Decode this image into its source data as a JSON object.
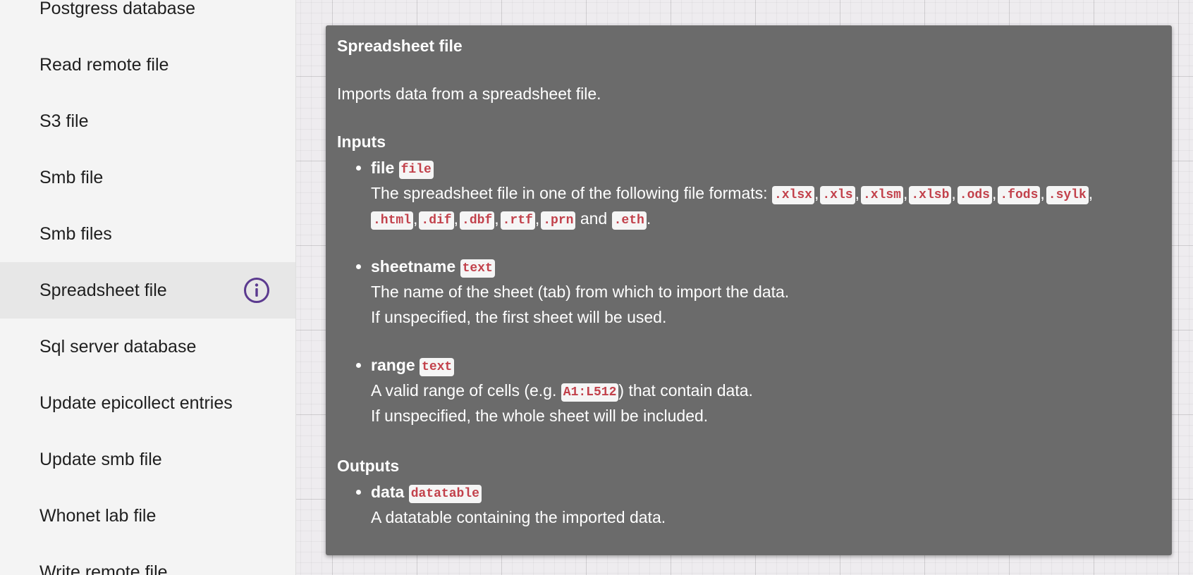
{
  "sidebar": {
    "items": [
      {
        "label": "Postgress database"
      },
      {
        "label": "Read remote file"
      },
      {
        "label": "S3 file"
      },
      {
        "label": "Smb file"
      },
      {
        "label": "Smb files"
      },
      {
        "label": "Spreadsheet file",
        "active": true,
        "icon": "info-icon"
      },
      {
        "label": "Sql server database"
      },
      {
        "label": "Update epicollect entries"
      },
      {
        "label": "Update smb file"
      },
      {
        "label": "Whonet lab file"
      },
      {
        "label": "Write remote file"
      }
    ]
  },
  "colors": {
    "info_icon": "#5b3a8f",
    "panel_bg": "#6b6b6b",
    "badge_text": "#c2414b"
  },
  "doc": {
    "title": "Spreadsheet file",
    "description": "Imports data from a spreadsheet file.",
    "inputs_title": "Inputs",
    "outputs_title": "Outputs",
    "inputs": [
      {
        "name": "file",
        "type": "file",
        "desc_prefix": "The spreadsheet file in one of the following file formats:",
        "formats": [
          ".xlsx",
          ".xls",
          ".xlsm",
          ".xlsb",
          ".ods",
          ".fods",
          ".sylk",
          ".html",
          ".dif",
          ".dbf",
          ".rtf",
          ".prn"
        ],
        "and_word": "and",
        "last_format": ".eth"
      },
      {
        "name": "sheetname",
        "type": "text",
        "line1": "The name of the sheet (tab) from which to import the data.",
        "line2": "If unspecified, the first sheet will be used."
      },
      {
        "name": "range",
        "type": "text",
        "line1_prefix": "A valid range of cells (e.g.",
        "example": "A1:L512",
        "line1_suffix": ") that contain data.",
        "line2": "If unspecified, the whole sheet will be included."
      }
    ],
    "outputs": [
      {
        "name": "data",
        "type": "datatable",
        "line1": "A datatable containing the imported data."
      }
    ]
  }
}
